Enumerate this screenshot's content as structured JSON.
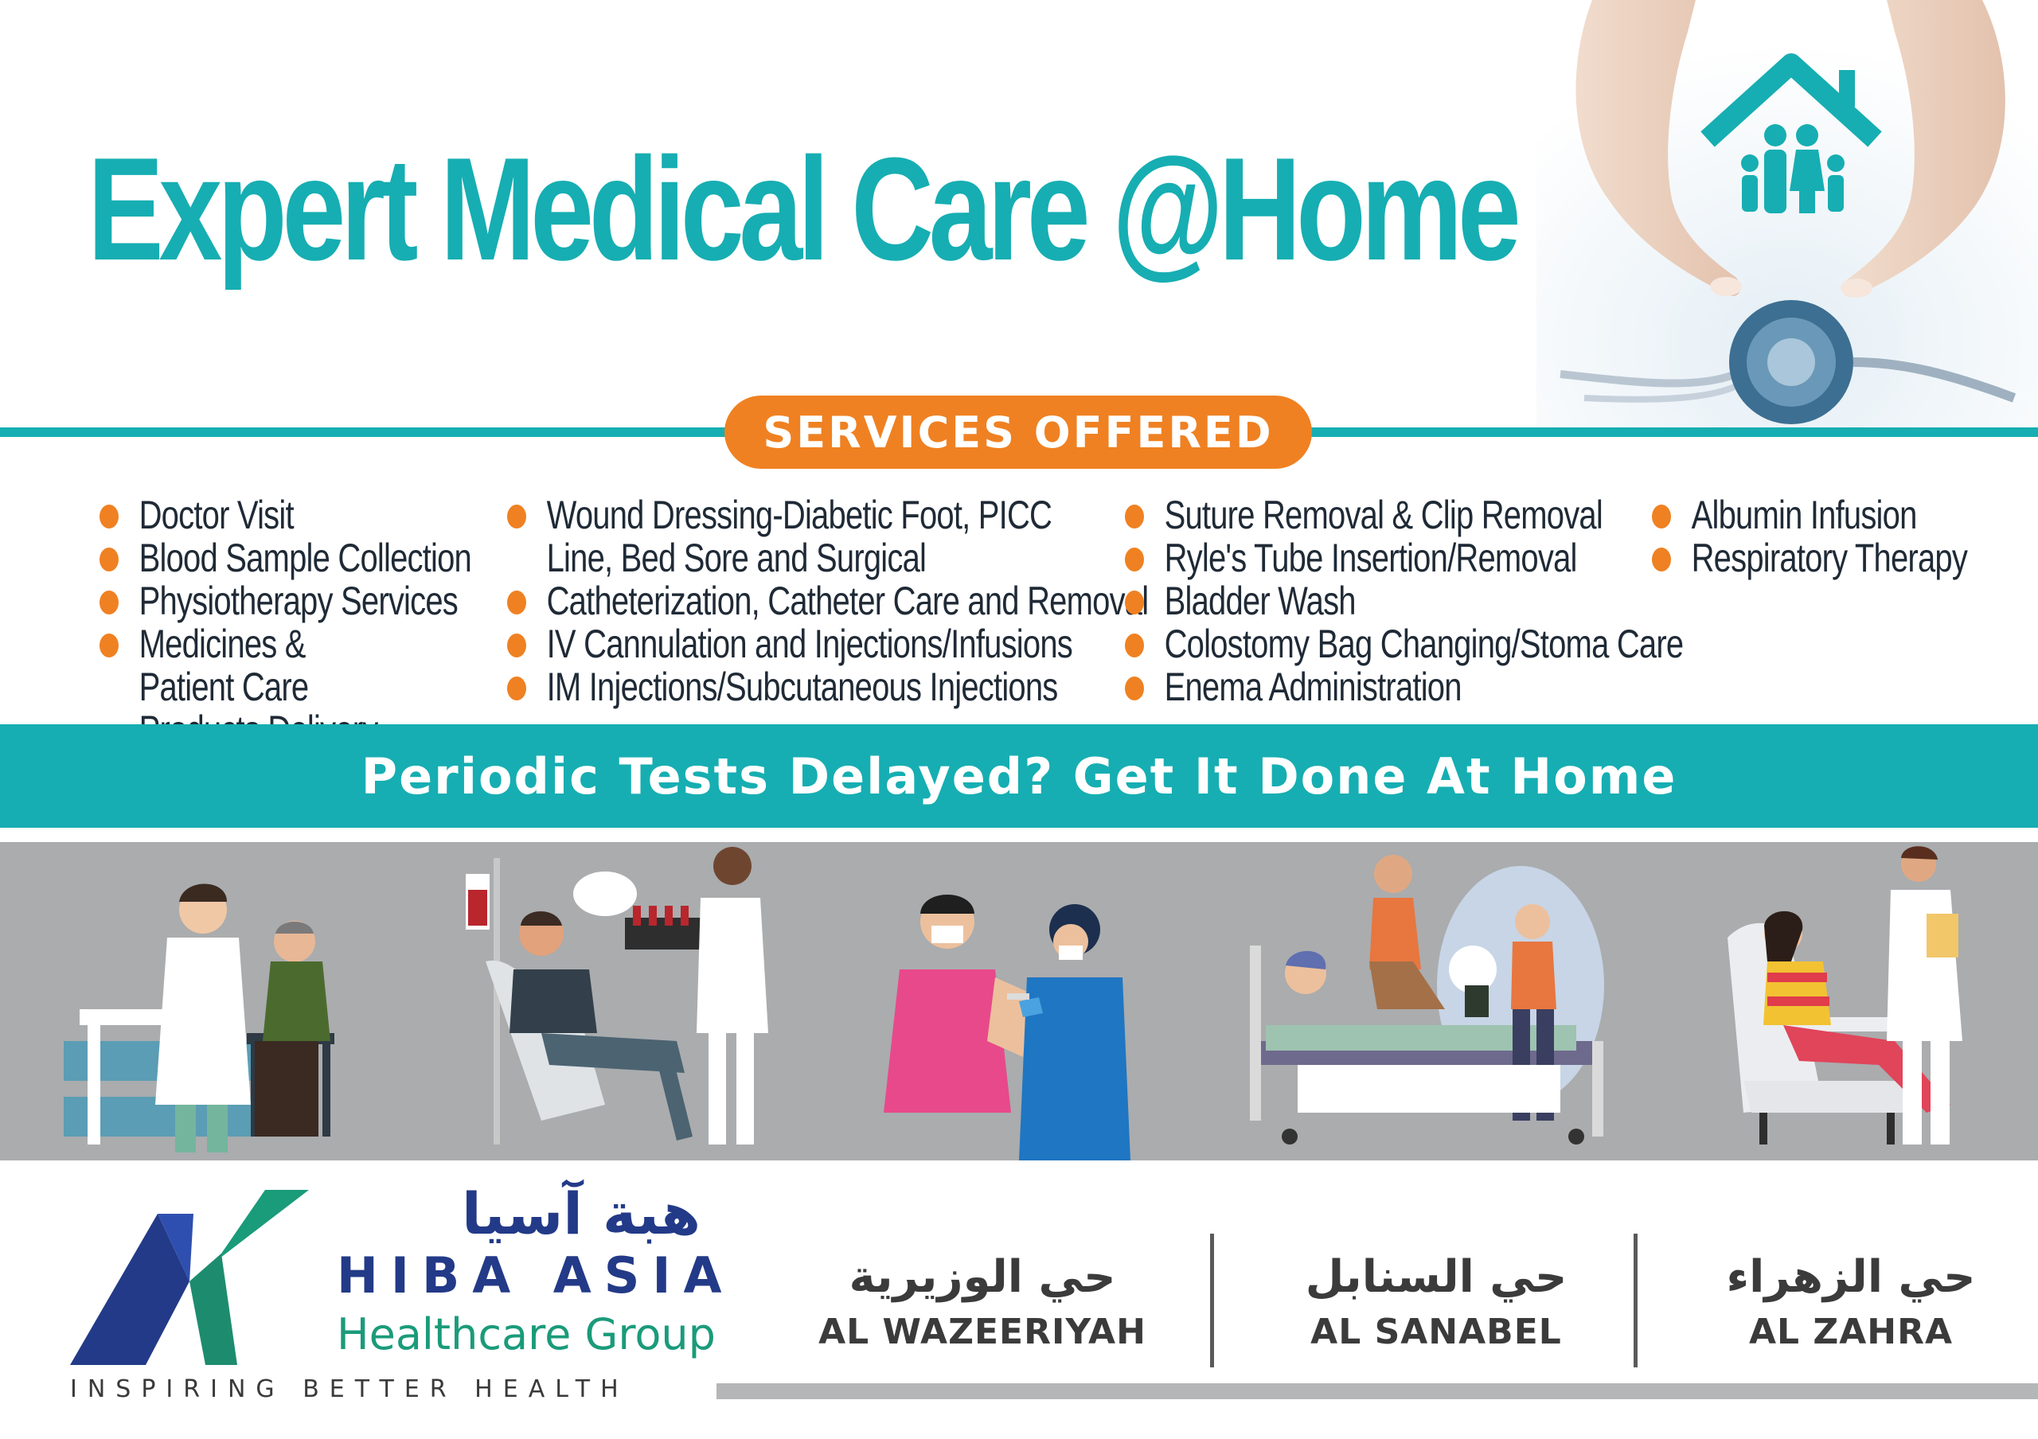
{
  "headline": "Expert Medical Care @Home",
  "services_title": "SERVICES OFFERED",
  "services": {
    "col1": [
      "Doctor Visit",
      "Blood Sample Collection",
      "Physiotherapy Services",
      "Medicines & Patient Care Products Delivery"
    ],
    "col2": [
      "Wound Dressing-Diabetic Foot, PICC Line, Bed Sore and Surgical",
      "Catheterization, Catheter Care and Removal",
      "IV Cannulation and Injections/Infusions",
      "IM Injections/Subcutaneous Injections"
    ],
    "col3": [
      "Suture Removal & Clip Removal",
      "Ryle's Tube Insertion/Removal",
      "Bladder Wash",
      "Colostomy Bag Changing/Stoma Care",
      "Enema Administration"
    ],
    "col4": [
      "Albumin Infusion",
      "Respiratory Therapy"
    ]
  },
  "banner": "Periodic Tests Delayed? Get It Done At Home",
  "brand": {
    "arabic": "هبة آسيا",
    "name": "HIBA ASIA",
    "subtitle": "Healthcare Group",
    "tagline": "INSPIRING BETTER HEALTH"
  },
  "branches": [
    {
      "arabic": "حي الوزيرية",
      "name": "AL WAZEERIYAH"
    },
    {
      "arabic": "حي السنابل",
      "name": "AL SANABEL"
    },
    {
      "arabic": "حي الزهراء",
      "name": "AL ZAHRA"
    }
  ],
  "icons": [
    "protective-hands-icon",
    "family-house-icon",
    "stethoscope-icon",
    "bullet-dot-icon",
    "hiba-asia-logo-icon"
  ],
  "colors": {
    "teal": "#16aeb2",
    "orange": "#ef8122",
    "navy": "#233a88",
    "green": "#1a9b7a",
    "band_gray": "#aaacae",
    "text_dark": "#1f2a36"
  }
}
